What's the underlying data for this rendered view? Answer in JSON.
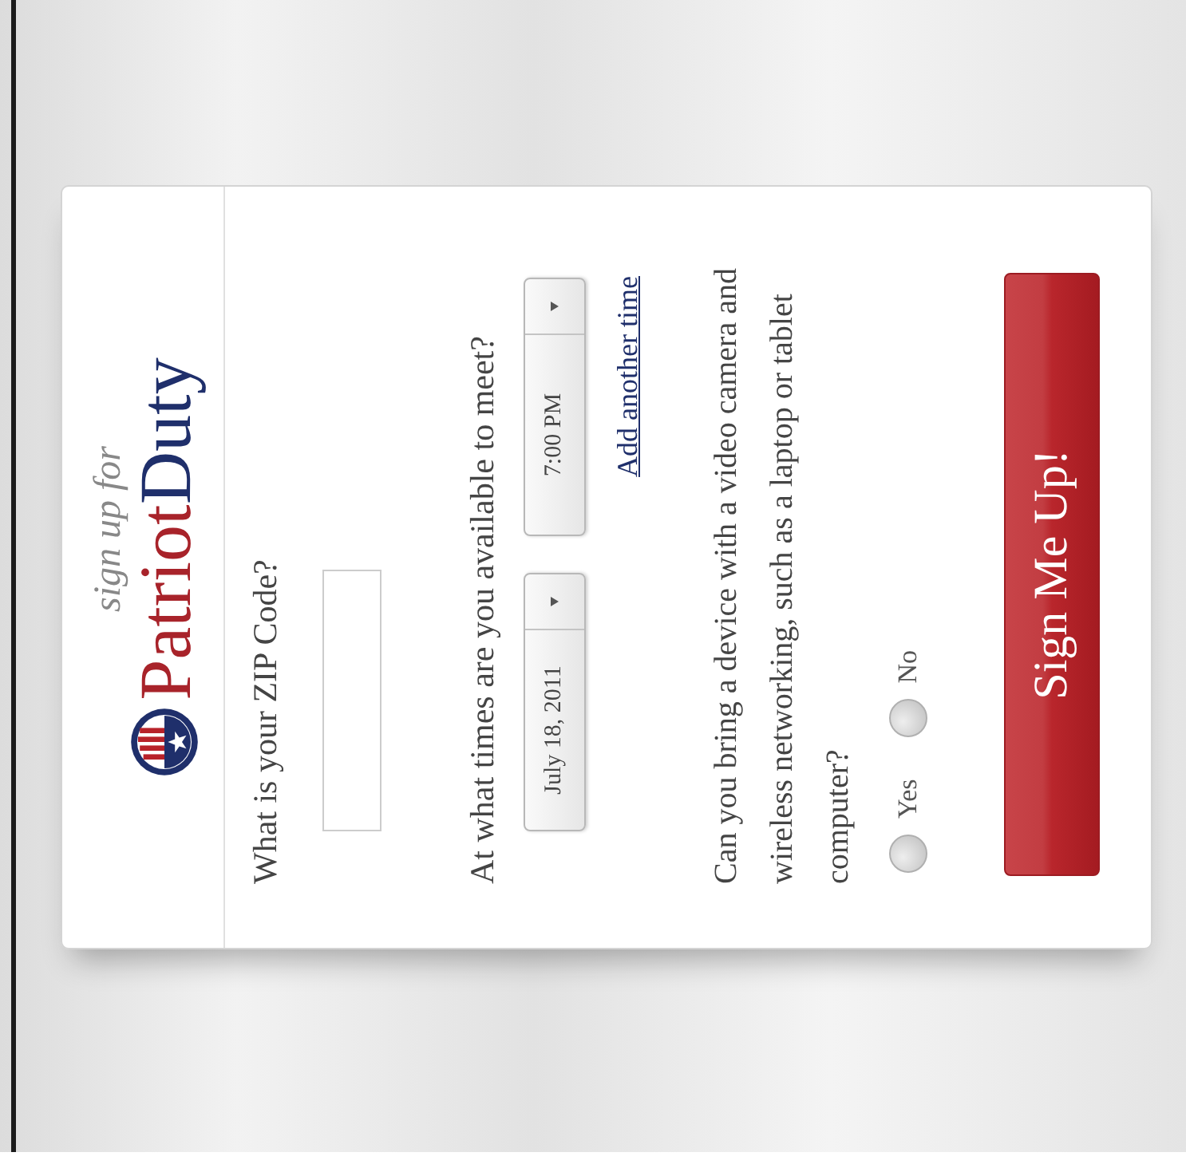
{
  "header": {
    "tagline": "sign up for",
    "brand_first": "Patriot",
    "brand_second": "Duty"
  },
  "zip": {
    "label": "What is your ZIP Code?"
  },
  "times": {
    "label": "At what times are you available to meet?",
    "date": "July 18, 2011",
    "time": "7:00 PM",
    "add_link": "Add another time"
  },
  "device": {
    "question": "Can you bring a device with a video camera and wireless networking, such as a laptop or tablet computer?",
    "options": [
      {
        "label": "Yes",
        "selected": false
      },
      {
        "label": "No",
        "selected": false
      }
    ]
  },
  "submit": "Sign Me Up!"
}
